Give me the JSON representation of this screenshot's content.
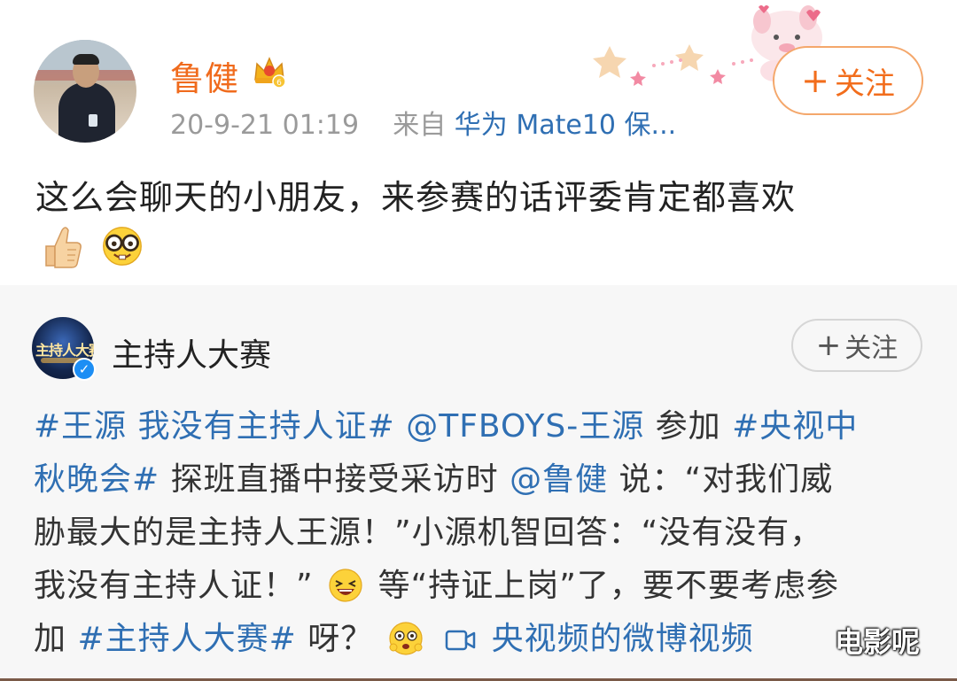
{
  "post": {
    "username": "鲁健",
    "timestamp": "20-9-21 01:19",
    "source_prefix": "来自",
    "source_device": "华为 Mate10 保...",
    "follow_label": "关注",
    "follow_plus": "+",
    "text": "这么会聊天的小朋友，来参赛的话评委肯定都喜欢",
    "emojis": [
      "thumbs-up-icon",
      "nerd-face-icon"
    ]
  },
  "repost": {
    "account_name": "主持人大赛",
    "avatar_text": "主持人大赛",
    "verified_mark": "✓",
    "follow_label": "关注",
    "follow_plus": "+",
    "lines": {
      "l1_tag1": "#王源 我没有主持人证#",
      "l1_mention": "@TFBOYS-王源",
      "l1_text": " 参加",
      "l1_tag2": "#央视中",
      "l2_tag2": "秋晚会#",
      "l2_text": " 探班直播中接受采访时 ",
      "l2_mention": "@鲁健",
      "l2_text2": " 说：“对我们威",
      "l3_text": "胁最大的是主持人王源！”小源机智回答：“没有没有，",
      "l4_text": "我没有主持人证！”",
      "l4_text2": "等“持证上岗”了，要不要考虑参",
      "l5_text": "加",
      "l5_tag": "#主持人大赛#",
      "l5_text2": " 呀？",
      "l5_video": "央视频的微博视频"
    }
  },
  "watermark": "电影呢",
  "colors": {
    "username": "#f06b1d",
    "link": "#2f6fb3",
    "meta": "#9a9a9a",
    "follow_border": "#f4a76b"
  }
}
